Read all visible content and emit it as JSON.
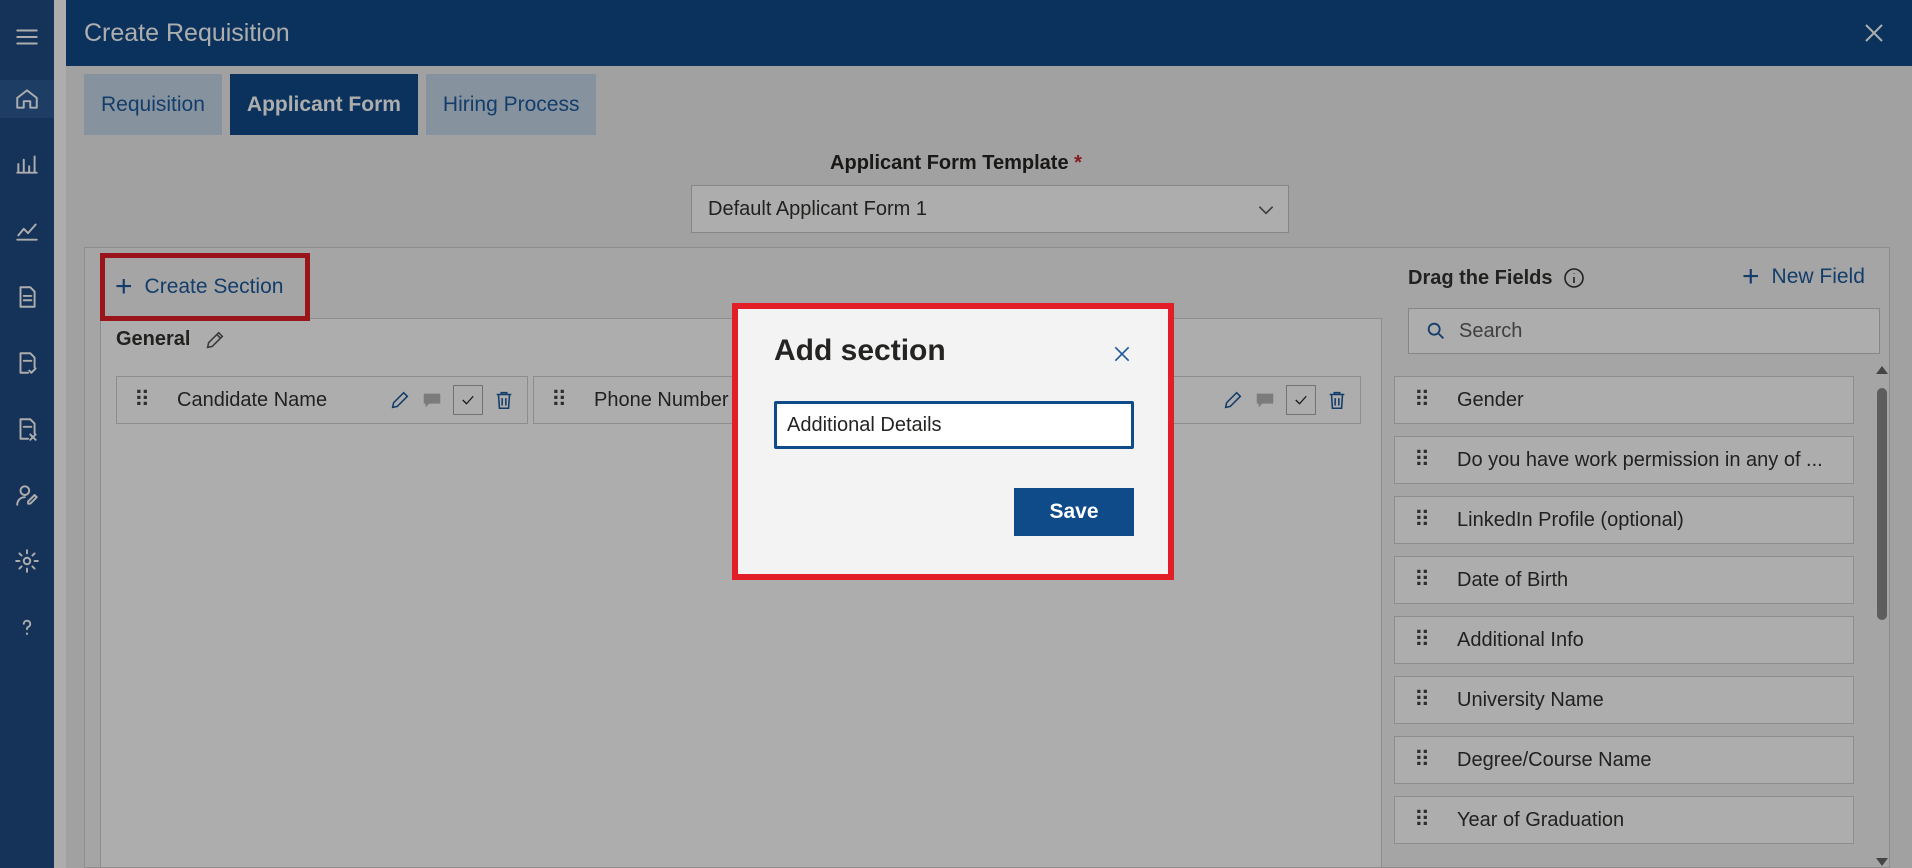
{
  "header": {
    "title": "Create Requisition"
  },
  "tabs": [
    {
      "label": "Requisition",
      "active": false
    },
    {
      "label": "Applicant Form",
      "active": true
    },
    {
      "label": "Hiring Process",
      "active": false
    }
  ],
  "template": {
    "label": "Applicant Form Template",
    "required_mark": "*",
    "selected": "Default Applicant Form 1"
  },
  "builder": {
    "create_section_label": "Create Section",
    "section": {
      "title": "General",
      "fields": [
        {
          "name": "Candidate Name"
        },
        {
          "name": "Phone Number"
        }
      ]
    }
  },
  "right_panel": {
    "title": "Drag the Fields",
    "new_field_label": "New Field",
    "search_placeholder": "Search",
    "fields": [
      "Gender",
      "Do you have work permission in any of ...",
      "LinkedIn Profile (optional)",
      "Date of Birth",
      "Additional Info",
      "University Name",
      "Degree/Course Name",
      "Year of Graduation"
    ]
  },
  "modal": {
    "title": "Add section",
    "input_value": "Additional Details",
    "save_label": "Save"
  },
  "colors": {
    "brand": "#0f4a89",
    "highlight": "#e21f26",
    "link": "#1d5a9c"
  }
}
